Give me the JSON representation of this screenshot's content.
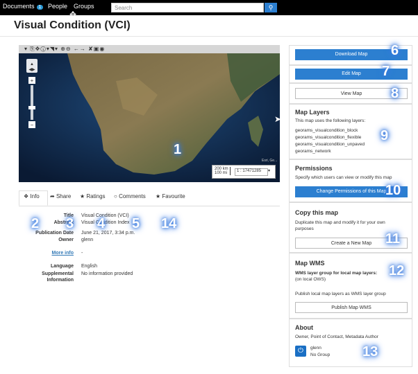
{
  "topnav": {
    "documents": "Documents",
    "documents_count": "1",
    "people": "People",
    "groups": "Groups",
    "search_placeholder": "Search"
  },
  "page_title": "Visual Condition (VCI)",
  "map": {
    "scale_km": "200 km",
    "scale_mi": "100 mi",
    "scale_ratio": "1 : 17471285",
    "attribution": "Esri, Ge..."
  },
  "tabs": [
    "Info",
    "Share",
    "Ratings",
    "Comments",
    "Favourite"
  ],
  "info": {
    "title_label": "Title",
    "title_value": "Visual Condition (VCI)",
    "abstract_label": "Abstract",
    "abstract_value": "Visual Condition Index",
    "pubdate_label": "Publication Date",
    "pubdate_value": "June 21, 2017, 3:34 p.m.",
    "owner_label": "Owner",
    "owner_value": "glenn",
    "more_info": "More info",
    "more_info_value": "-",
    "language_label": "Language",
    "language_value": "English",
    "supp_label_1": "Supplemental",
    "supp_label_2": "Information",
    "supp_value": "No information provided"
  },
  "sidebar": {
    "download_map": "Download Map",
    "edit_map": "Edit Map",
    "view_map": "View Map",
    "layers_heading": "Map Layers",
    "layers_intro": "This map uses the following layers:",
    "layers": [
      "georams_visualcondition_block",
      "georams_visualcondition_flexible",
      "georams_visualcondition_unpaved",
      "georams_network"
    ],
    "permissions_heading": "Permissions",
    "permissions_text": "Specify which users can view or modify this map",
    "change_permissions": "Change Permissions of this Map",
    "copy_heading": "Copy this map",
    "copy_text_1": "Duplicate this map and modify it for your own",
    "copy_text_2": "purposes",
    "create_map": "Create a New Map",
    "wms_heading": "Map WMS",
    "wms_group": "WMS layer group for local map layers:",
    "wms_local": "(on local OWS)",
    "wms_publish_text": "Publish local map layers as WMS layer group",
    "publish_wms": "Publish Map WMS",
    "about_heading": "About",
    "about_text": "Owner, Point of Contact, Metadata Author",
    "about_user": "glenn",
    "about_group": "No Group"
  },
  "callouts": [
    "1",
    "2",
    "3",
    "4",
    "5",
    "14",
    "6",
    "7",
    "8",
    "9",
    "10",
    "11",
    "12",
    "13"
  ],
  "colors": {
    "primary": "#2c7fd0",
    "topbar": "#000000",
    "callout_glow": "#3a7be0"
  }
}
